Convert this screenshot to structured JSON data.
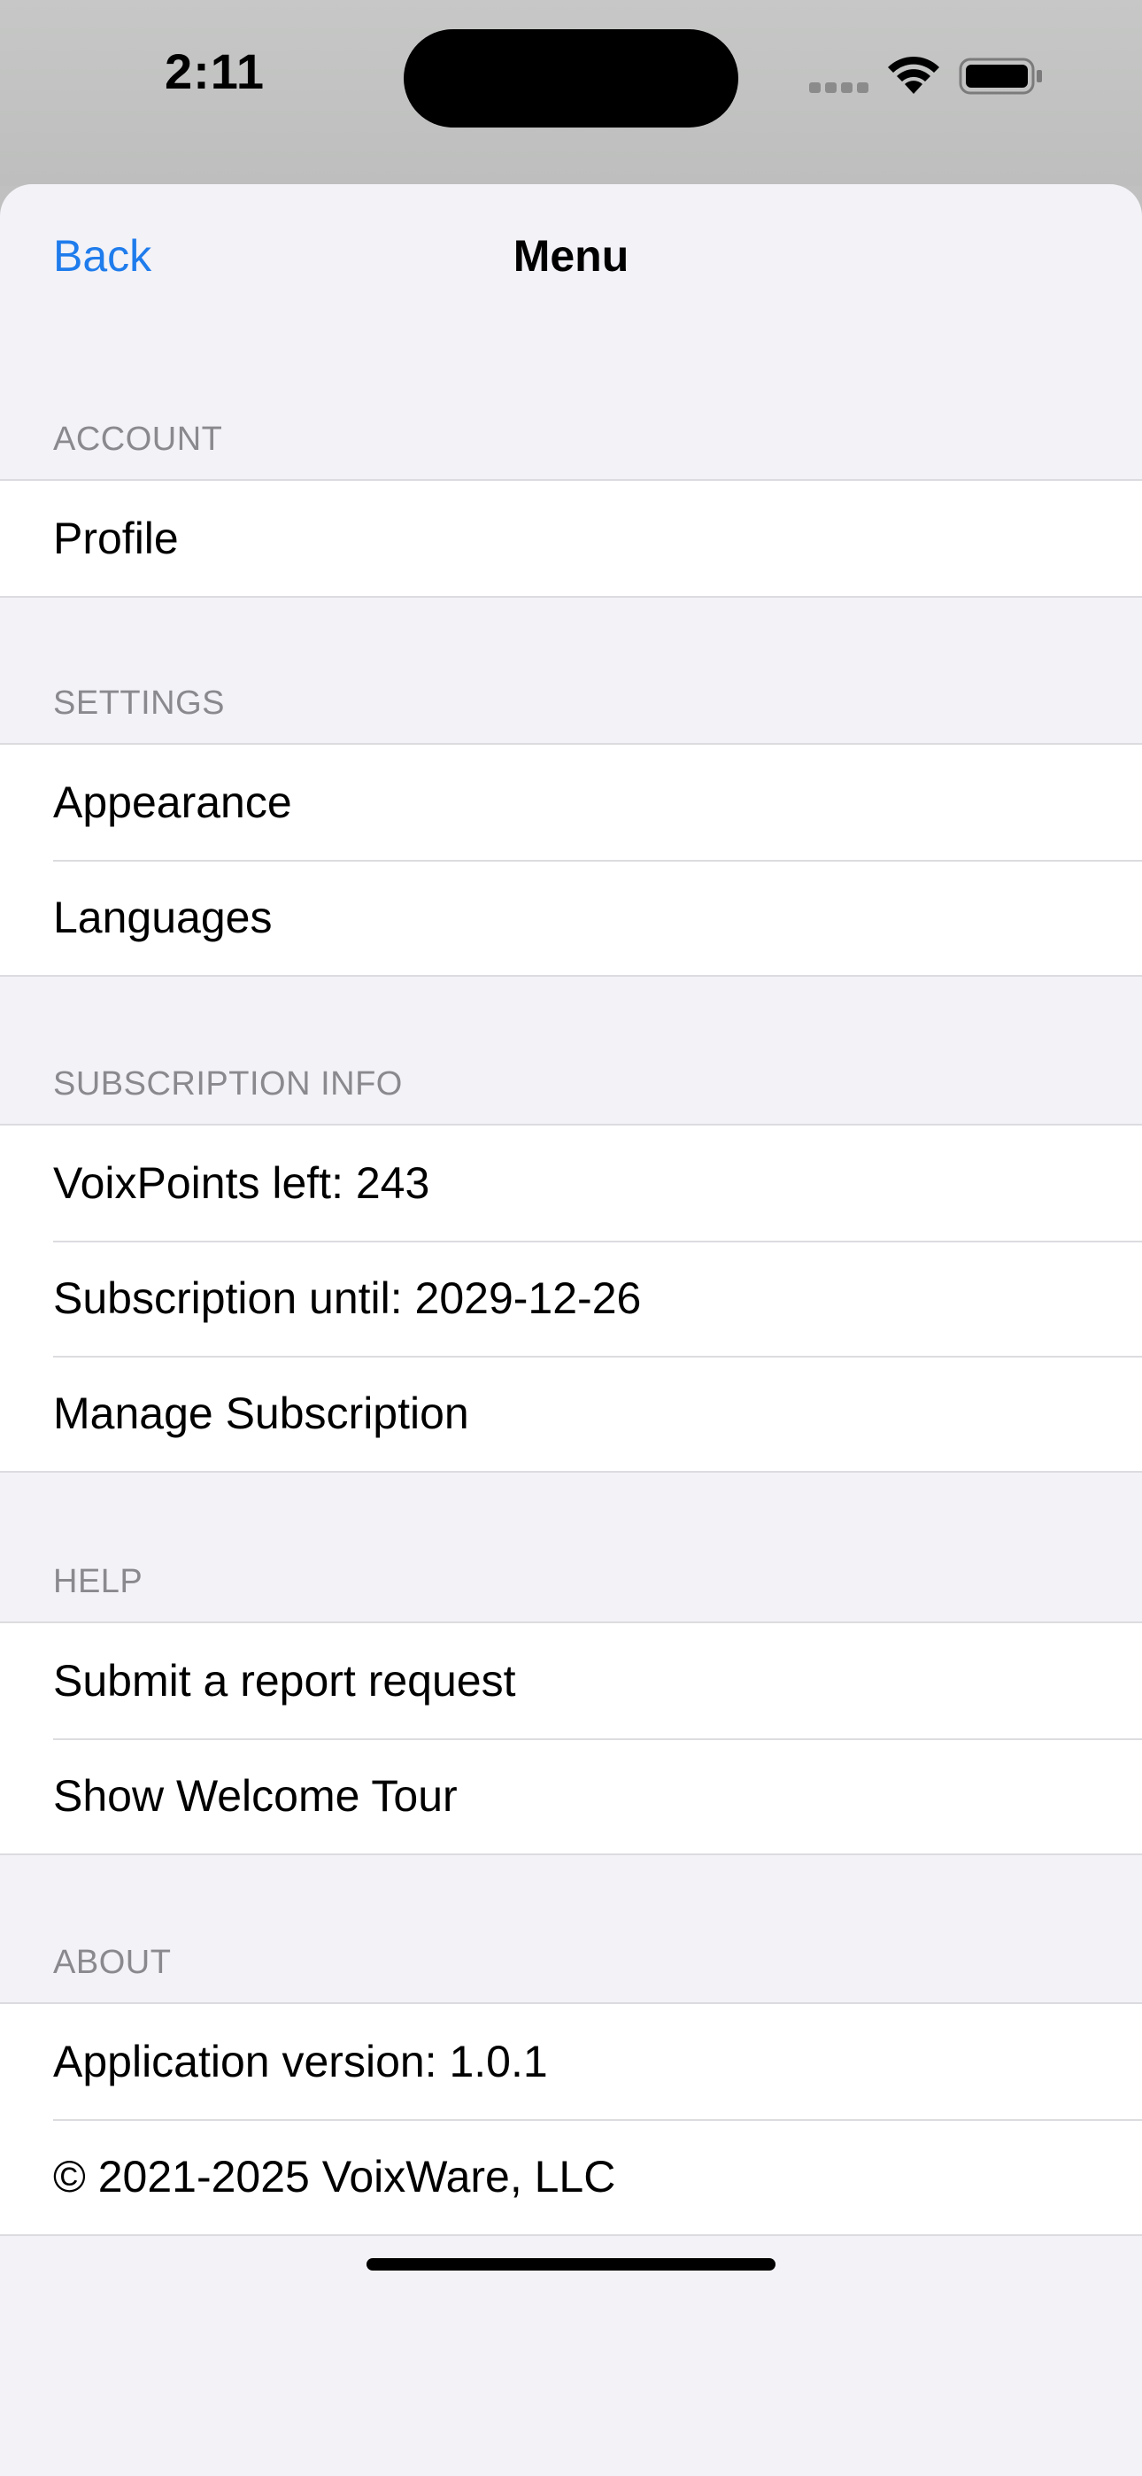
{
  "status_bar": {
    "time": "2:11"
  },
  "nav": {
    "back_label": "Back",
    "title": "Menu"
  },
  "sections": {
    "account": {
      "header": "ACCOUNT",
      "items": [
        "Profile"
      ]
    },
    "settings": {
      "header": "SETTINGS",
      "items": [
        "Appearance",
        "Languages"
      ]
    },
    "subscription": {
      "header": "SUBSCRIPTION INFO",
      "items": [
        "VoixPoints left: 243",
        "Subscription until: 2029-12-26",
        "Manage Subscription"
      ]
    },
    "help": {
      "header": "HELP",
      "items": [
        "Submit a report request",
        "Show Welcome Tour"
      ]
    },
    "about": {
      "header": "ABOUT",
      "items": [
        "Application version: 1.0.1",
        "© 2021-2025 VoixWare, LLC"
      ]
    }
  },
  "colors": {
    "accent": "#1f7cec",
    "background": "#f2f2f7",
    "section_header": "#8a8a8e"
  },
  "icons": [
    "signal-icon",
    "wifi-icon",
    "battery-icon"
  ]
}
